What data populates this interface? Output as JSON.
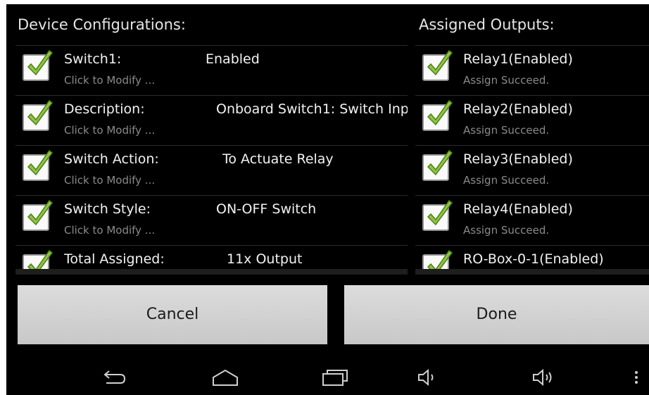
{
  "left_panel": {
    "header": "Device Configurations:",
    "rows": [
      {
        "label": "Switch1:",
        "value": "Enabled",
        "sub": "Click to Modify ..."
      },
      {
        "label": "Description:",
        "value": "Onboard Switch1: Switch Inp",
        "sub": "Click to Modify ..."
      },
      {
        "label": "Switch Action:",
        "value": "To Actuate Relay",
        "sub": "Click to Modify ..."
      },
      {
        "label": "Switch Style:",
        "value": "ON-OFF Switch",
        "sub": "Click to Modify ..."
      },
      {
        "label": "Total Assigned:",
        "value": "11x Output",
        "sub": ""
      }
    ]
  },
  "right_panel": {
    "header": "Assigned Outputs:",
    "rows": [
      {
        "label": "Relay1(Enabled)",
        "sub": "Assign Succeed."
      },
      {
        "label": "Relay2(Enabled)",
        "sub": "Assign Succeed."
      },
      {
        "label": "Relay3(Enabled)",
        "sub": "Assign Succeed."
      },
      {
        "label": "Relay4(Enabled)",
        "sub": "Assign Succeed."
      },
      {
        "label": "RO-Box-0-1(Enabled)",
        "sub": ""
      }
    ]
  },
  "buttons": {
    "cancel": "Cancel",
    "done": "Done"
  },
  "navbar": {
    "icons": [
      "back-icon",
      "home-icon",
      "recents-icon",
      "volume-down-icon",
      "volume-up-icon",
      "overflow-menu-icon"
    ]
  },
  "colors": {
    "background": "#000000",
    "check_green": "#8cc63f",
    "button_bg": "#d4d4d4",
    "subtext": "#8a8a8a"
  }
}
